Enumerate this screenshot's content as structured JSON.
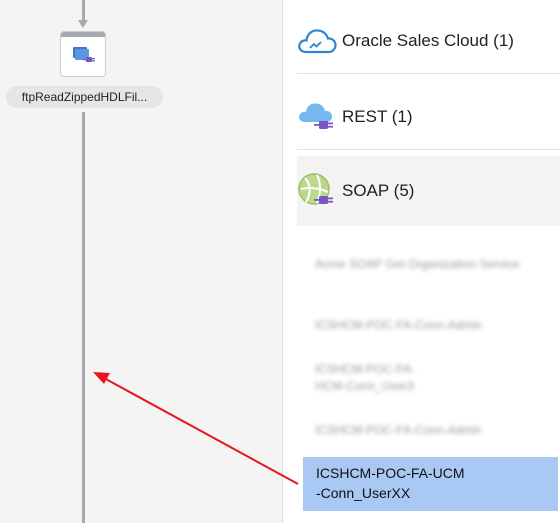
{
  "canvas": {
    "node_label": "ftpReadZippedHDLFil..."
  },
  "panel": {
    "categories": [
      {
        "label": "Oracle Sales Cloud (1)",
        "icon": "cloud-icon"
      },
      {
        "label": "REST (1)",
        "icon": "rest-cloud-plug-icon"
      },
      {
        "label": "SOAP (5)",
        "icon": "soap-globe-plug-icon"
      }
    ],
    "soap_connections": [
      {
        "label": "Acme SOAP Get Organization Service",
        "obscured": true
      },
      {
        "label": "ICSHCM-POC-FA-Conn-Admin",
        "obscured": true
      },
      {
        "label": "ICSHCM-POC-FA-HCM-Conn_User3",
        "obscured": true
      },
      {
        "label": "ICSHCM-POC-FA-Conn-Admin",
        "obscured": true
      },
      {
        "label": "ICSHCM-POC-FA-UCM-Conn_UserXX",
        "obscured": false,
        "selected": true
      }
    ]
  },
  "colors": {
    "selection": "#a9c8f3",
    "annotation_arrow": "#e8161b",
    "flow_line": "#a6aab0"
  }
}
